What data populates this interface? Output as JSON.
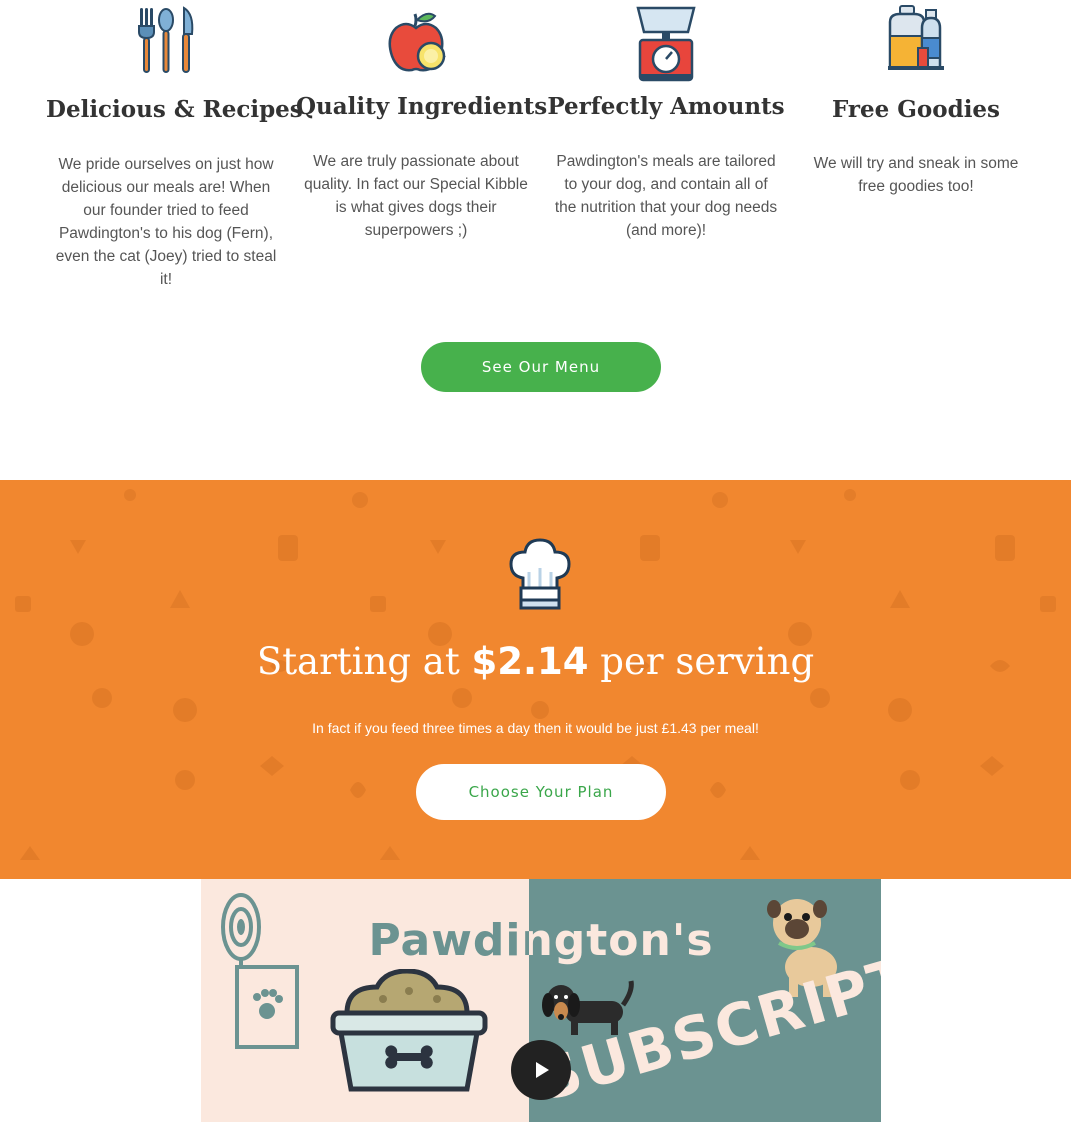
{
  "features": [
    {
      "icon": "utensils-icon",
      "title": "Delicious & Recipes",
      "description": "We pride ourselves on just how delicious our meals are! When our founder tried to feed Pawdington's to his dog (Fern), even the cat (Joey) tried to steal it!"
    },
    {
      "icon": "apple-icon",
      "title": "Quality Ingredients",
      "description": "We are truly passionate about quality. In fact our Special Kibble is what gives dogs their superpowers ;)"
    },
    {
      "icon": "kitchen-scale-icon",
      "title": "Perfectly Amounts",
      "description": "Pawdington's meals are tailored to your dog, and contain all of the nutrition that your dog needs (and more)!"
    },
    {
      "icon": "goodies-bottles-icon",
      "title": "Free Goodies",
      "description": "We will try and sneak in some free goodies too!"
    }
  ],
  "menu_button": "See Our Menu",
  "pricing": {
    "prefix": "Starting at",
    "amount": "$2.14",
    "suffix": "per serving",
    "note": "In fact if you feed three times a day then it would be just £1.43 per meal!",
    "button": "Choose Your Plan"
  },
  "video": {
    "brand": "Pawdington's",
    "slanted_text": "SUBSCRIPTION"
  },
  "colors": {
    "green": "#47b14c",
    "orange": "#f1872f",
    "teal": "#6b9391",
    "peach": "#fbe8de"
  }
}
